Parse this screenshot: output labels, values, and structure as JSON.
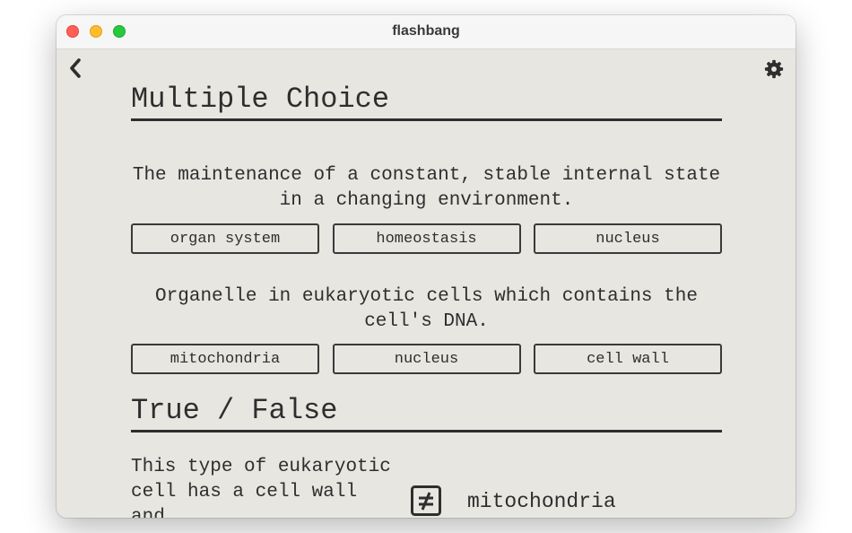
{
  "window": {
    "title": "flashbang"
  },
  "icons": {
    "back": "chevron-left-icon",
    "settings": "gear-icon",
    "not_equal": "not-equal-icon"
  },
  "multiple_choice": {
    "heading": "Multiple Choice",
    "questions": [
      {
        "prompt": "The maintenance of a constant, stable internal state in a changing environment.",
        "choices": [
          "organ system",
          "homeostasis",
          "nucleus"
        ]
      },
      {
        "prompt": "Organelle in eukaryotic cells which contains the cell's DNA.",
        "choices": [
          "mitochondria",
          "nucleus",
          "cell wall"
        ]
      }
    ]
  },
  "true_false": {
    "heading": "True / False",
    "prompt": "This type of eukaryotic cell has a cell wall and",
    "answer": "mitochondria"
  },
  "colors": {
    "background": "#e8e6e1",
    "ink": "#2e2e2e",
    "titlebar": "#f6f6f6"
  }
}
